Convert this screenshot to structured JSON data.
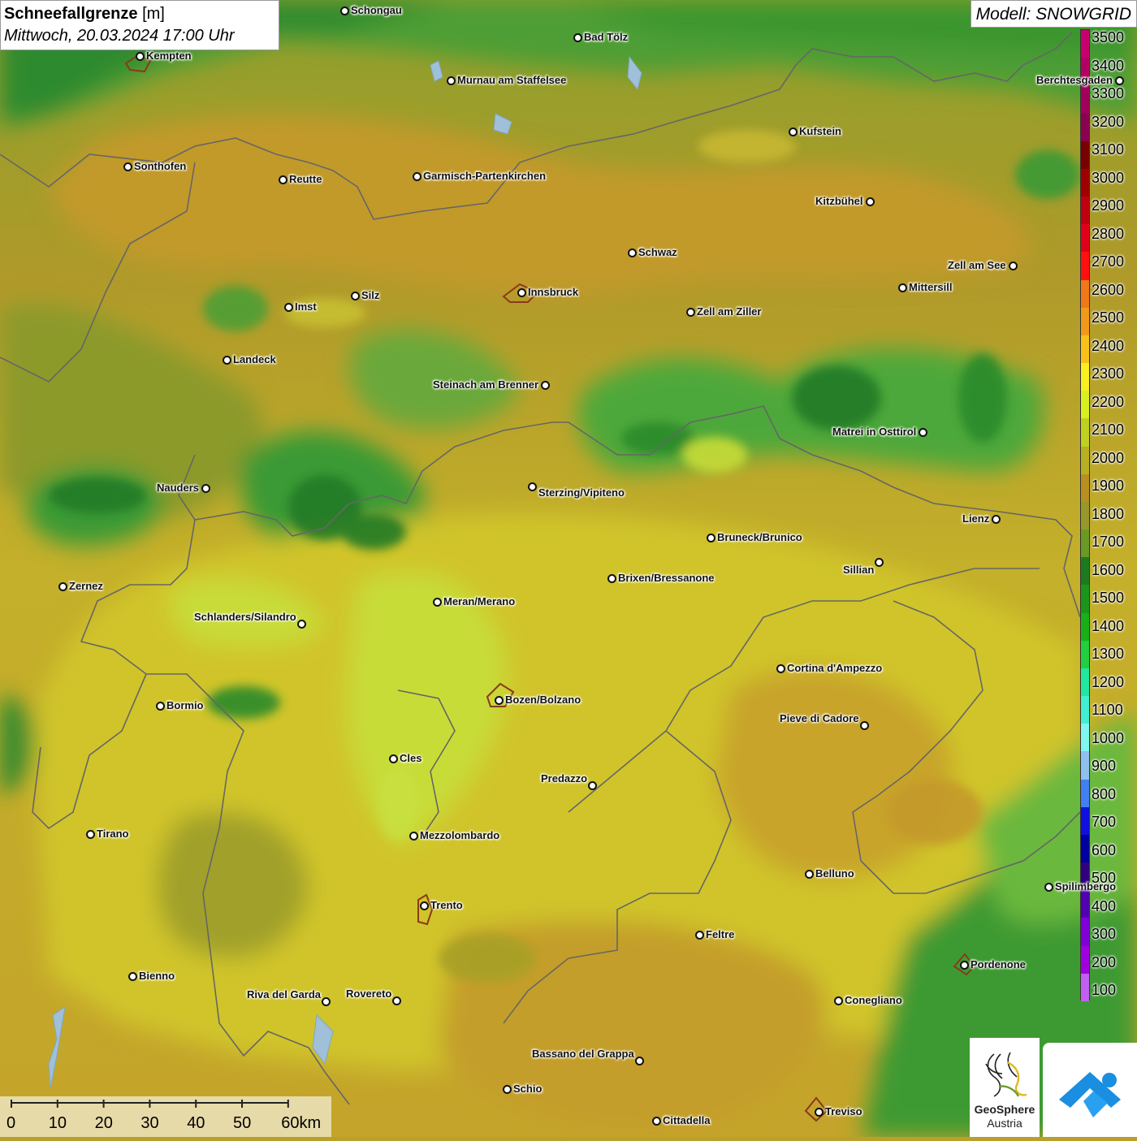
{
  "header": {
    "title_bold": "Schneefallgrenze",
    "title_unit": "[m]",
    "datetime": "Mittwoch, 20.03.2024 17:00 Uhr",
    "model": "Modell: SNOWGRID"
  },
  "legend": {
    "values": [
      "3500",
      "3400",
      "3300",
      "3200",
      "3100",
      "3000",
      "2900",
      "2800",
      "2700",
      "2600",
      "2500",
      "2400",
      "2300",
      "2200",
      "2100",
      "2000",
      "1900",
      "1800",
      "1700",
      "1600",
      "1500",
      "1400",
      "1300",
      "1200",
      "1100",
      "1000",
      "900",
      "800",
      "700",
      "600",
      "500",
      "400",
      "300",
      "200",
      "100"
    ],
    "colors": [
      "#c8006e",
      "#b40064",
      "#a0005a",
      "#8c0050",
      "#780000",
      "#a00000",
      "#c00010",
      "#e0001a",
      "#ff1010",
      "#f07818",
      "#f09a18",
      "#f8c018",
      "#f8f020",
      "#d8f020",
      "#c0d020",
      "#b8b020",
      "#b89020",
      "#98982a",
      "#6a9a24",
      "#1e7a1e",
      "#1a961a",
      "#18b018",
      "#20d040",
      "#20e8a0",
      "#40f0d0",
      "#80f8f0",
      "#90c0f0",
      "#4080f0",
      "#1010e0",
      "#0000a0",
      "#300080",
      "#5000b0",
      "#8000d8",
      "#a000e0",
      "#c060f0"
    ]
  },
  "cities": [
    {
      "name": "Schongau"
    },
    {
      "name": "Kempten"
    },
    {
      "name": "Bad Tölz"
    },
    {
      "name": "Murnau am Staffelsee"
    },
    {
      "name": "Berchtesgaden"
    },
    {
      "name": "Kufstein"
    },
    {
      "name": "Sonthofen"
    },
    {
      "name": "Reutte"
    },
    {
      "name": "Garmisch-Partenkirchen"
    },
    {
      "name": "Kitzbühel"
    },
    {
      "name": "Schwaz"
    },
    {
      "name": "Zell am See"
    },
    {
      "name": "Innsbruck"
    },
    {
      "name": "Mittersill"
    },
    {
      "name": "Imst"
    },
    {
      "name": "Silz"
    },
    {
      "name": "Zell am Ziller"
    },
    {
      "name": "Landeck"
    },
    {
      "name": "Steinach am Brenner"
    },
    {
      "name": "Matrei in Osttirol"
    },
    {
      "name": "Nauders"
    },
    {
      "name": "Sterzing/Vipiteno"
    },
    {
      "name": "Lienz"
    },
    {
      "name": "Bruneck/Brunico"
    },
    {
      "name": "Sillian"
    },
    {
      "name": "Zernez"
    },
    {
      "name": "Brixen/Bressanone"
    },
    {
      "name": "Meran/Merano"
    },
    {
      "name": "Schlanders/Silandro"
    },
    {
      "name": "Cortina d'Ampezzo"
    },
    {
      "name": "Bormio"
    },
    {
      "name": "Bozen/Bolzano"
    },
    {
      "name": "Pieve di Cadore"
    },
    {
      "name": "Cles"
    },
    {
      "name": "Predazzo"
    },
    {
      "name": "Tirano"
    },
    {
      "name": "Mezzolombardo"
    },
    {
      "name": "Belluno"
    },
    {
      "name": "Spilimbergo"
    },
    {
      "name": "Trento"
    },
    {
      "name": "Feltre"
    },
    {
      "name": "Pordenone"
    },
    {
      "name": "Bienno"
    },
    {
      "name": "Riva del Garda"
    },
    {
      "name": "Rovereto"
    },
    {
      "name": "Conegliano"
    },
    {
      "name": "Bassano del Grappa"
    },
    {
      "name": "Schio"
    },
    {
      "name": "Treviso"
    },
    {
      "name": "Cittadella"
    }
  ],
  "scale": {
    "ticks": [
      "0",
      "10",
      "20",
      "30",
      "40",
      "50",
      "60km"
    ]
  },
  "logos": {
    "geo_line1": "GeoSphere",
    "geo_line2": "Austria"
  },
  "colors": {
    "dark_green": "#2e8a2e",
    "mid_green": "#58a83a",
    "olive": "#98982a",
    "ochre": "#c49a2a",
    "yellow": "#d2c82a",
    "lime": "#c8e040"
  }
}
